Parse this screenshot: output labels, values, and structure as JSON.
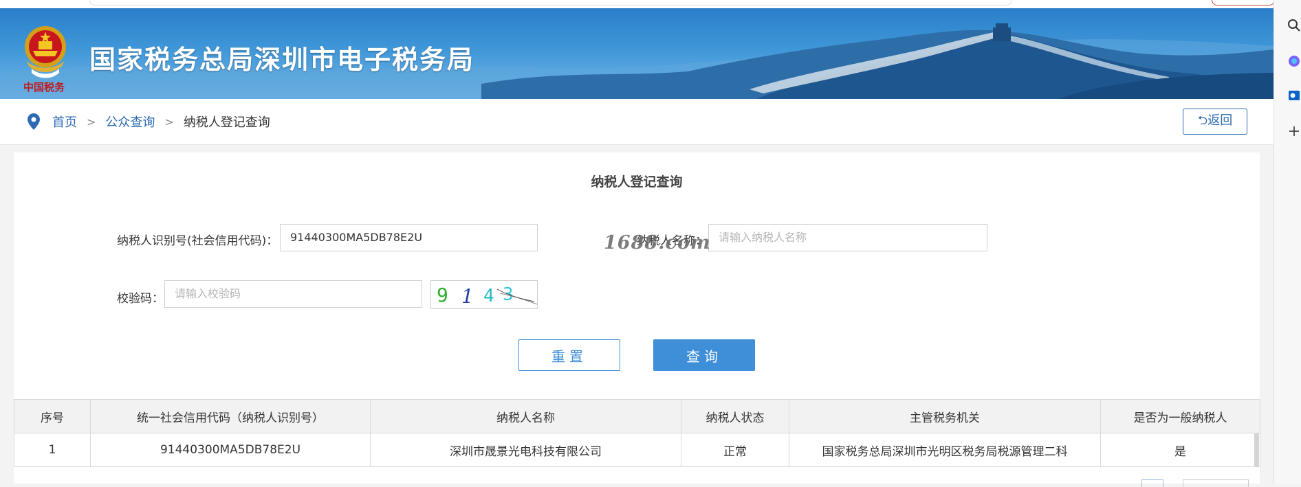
{
  "banner": {
    "title": "国家税务总局深圳市电子税务局",
    "brand_text": "中国税务"
  },
  "breadcrumb": {
    "home": "首页",
    "public_query": "公众查询",
    "current": "纳税人登记查询",
    "separator": ">"
  },
  "back_button": {
    "label": "⮌返回"
  },
  "form": {
    "title": "纳税人登记查询",
    "taxpayer_id_label": "纳税人识别号(社会信用代码)：",
    "taxpayer_id_value": "91440300MA5DB78E2U",
    "taxpayer_name_label": "纳税人名称：",
    "taxpayer_name_placeholder": "请输入纳税人名称",
    "verify_label": "校验码：",
    "verify_placeholder": "请输入校验码",
    "captcha_text": "9 1 4 3",
    "reset_label": "重置",
    "query_label": "查询"
  },
  "watermark": "1688.com",
  "table": {
    "headers": [
      "序号",
      "统一社会信用代码（纳税人识别号）",
      "纳税人名称",
      "纳税人状态",
      "主管税务机关",
      "是否为一般纳税人"
    ],
    "rows": [
      [
        "1",
        "91440300MA5DB78E2U",
        "深圳市晟景光电科技有限公司",
        "正常",
        "国家税务总局深圳市光明区税务局税源管理二科",
        "是"
      ]
    ]
  },
  "colors": {
    "primary": "#3e8fd8",
    "link": "#2c6bb3",
    "banner": "#2a7fc9"
  },
  "sidebar_icons": [
    "search-icon",
    "copilot-icon",
    "outlook-icon",
    "add-icon"
  ]
}
